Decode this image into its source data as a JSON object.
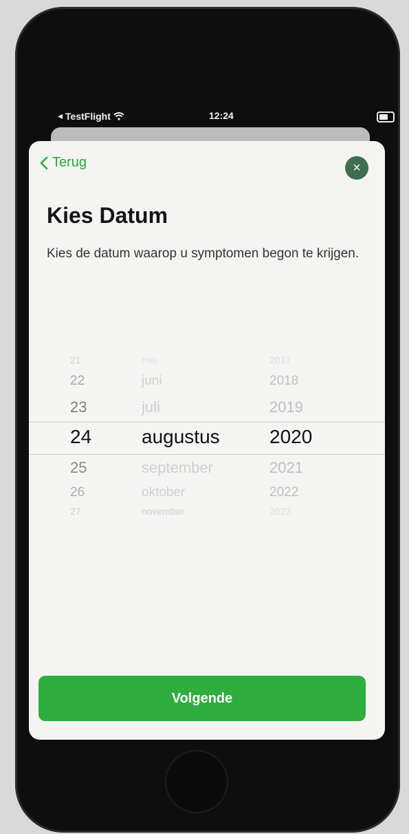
{
  "status_bar": {
    "back_app": "TestFlight",
    "time": "12:24"
  },
  "nav": {
    "back_label": "Terug",
    "close_label": "×"
  },
  "page": {
    "title": "Kies Datum",
    "subtitle": "Kies de datum waarop u symptomen begon te krijgen."
  },
  "date_picker": {
    "days": [
      "21",
      "22",
      "23",
      "24",
      "25",
      "26",
      "27"
    ],
    "months": [
      "mei",
      "juni",
      "juli",
      "augustus",
      "september",
      "oktober",
      "november"
    ],
    "years": [
      "2017",
      "2018",
      "2019",
      "2020",
      "2021",
      "2022",
      "2023"
    ],
    "selected": {
      "day": "24",
      "month": "augustus",
      "year": "2020"
    }
  },
  "primary_action": {
    "label": "Volgende"
  },
  "colors": {
    "accent_green": "#2fae3f",
    "close_button": "#3d6e50",
    "sheet_background": "#f4f4f2"
  }
}
